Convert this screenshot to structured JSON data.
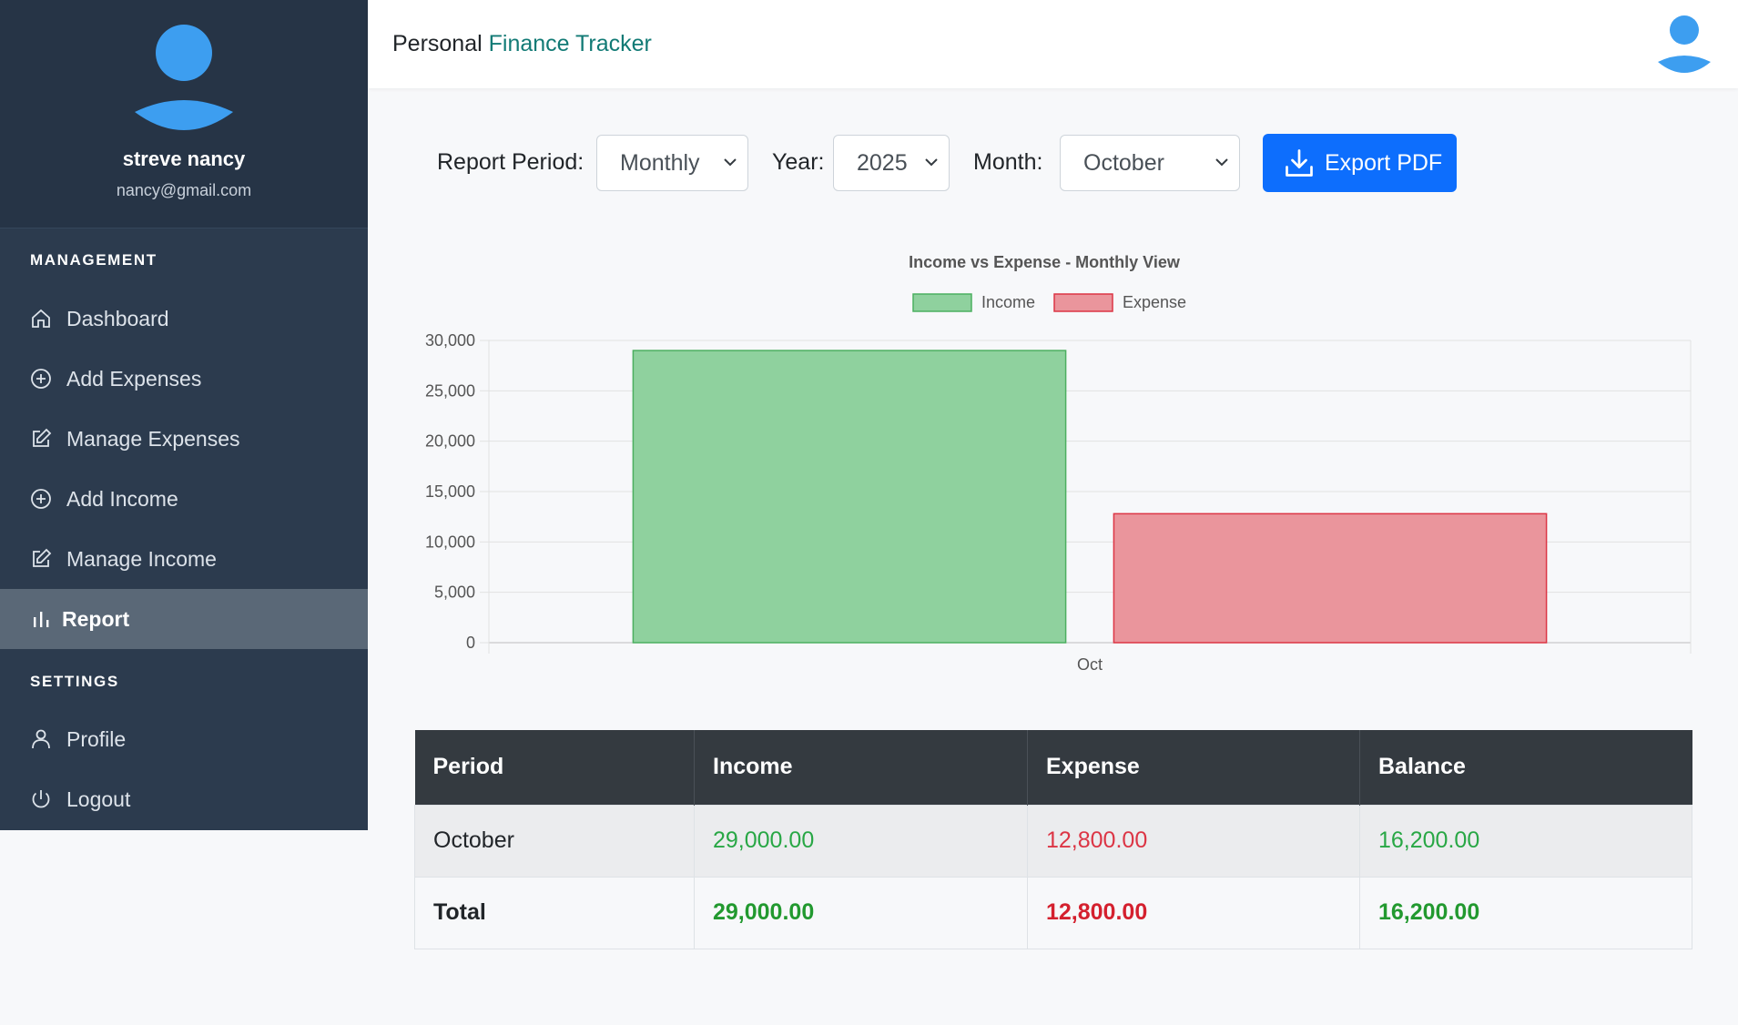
{
  "sidebar": {
    "user_name": "streve nancy",
    "user_email": "nancy@gmail.com",
    "management_title": "MANAGEMENT",
    "settings_title": "SETTINGS",
    "items": [
      {
        "label": "Dashboard",
        "icon": "home-icon"
      },
      {
        "label": "Add Expenses",
        "icon": "plus-circle-icon"
      },
      {
        "label": "Manage Expenses",
        "icon": "edit-icon"
      },
      {
        "label": "Add Income",
        "icon": "plus-circle-icon"
      },
      {
        "label": "Manage Income",
        "icon": "edit-icon"
      },
      {
        "label": "Report",
        "icon": "bar-chart-icon",
        "active": true
      }
    ],
    "settings_items": [
      {
        "label": "Profile",
        "icon": "person-icon"
      },
      {
        "label": "Logout",
        "icon": "power-icon"
      }
    ]
  },
  "header": {
    "brand_prefix": "Personal",
    "brand_accent": "Finance Tracker"
  },
  "controls": {
    "period_label": "Report Period:",
    "period_value": "Monthly",
    "year_label": "Year:",
    "year_value": "2025",
    "month_label": "Month:",
    "month_value": "October",
    "export_label": "Export PDF"
  },
  "chart_data": {
    "type": "bar",
    "title": "Income vs Expense - Monthly View",
    "categories": [
      "Oct"
    ],
    "series": [
      {
        "name": "Income",
        "values": [
          29000
        ],
        "color": "#8fd19e",
        "border": "#4caf60"
      },
      {
        "name": "Expense",
        "values": [
          12800
        ],
        "color": "#ea959c",
        "border": "#dc3545"
      }
    ],
    "ylim": [
      0,
      30000
    ],
    "yticks": [
      "30,000",
      "25,000",
      "20,000",
      "15,000",
      "10,000",
      "5,000",
      "0"
    ],
    "grid": true,
    "legend": "top"
  },
  "table": {
    "headers": [
      "Period",
      "Income",
      "Expense",
      "Balance"
    ],
    "rows": [
      {
        "period": "October",
        "income": "29,000.00",
        "expense": "12,800.00",
        "balance": "16,200.00"
      }
    ],
    "total": {
      "label": "Total",
      "income": "29,000.00",
      "expense": "12,800.00",
      "balance": "16,200.00"
    }
  },
  "colors": {
    "sidebar_bg": "#2c3b4e",
    "accent": "#117a75",
    "primary": "#0d6efd",
    "income": "#28a745",
    "expense": "#dc3545"
  }
}
